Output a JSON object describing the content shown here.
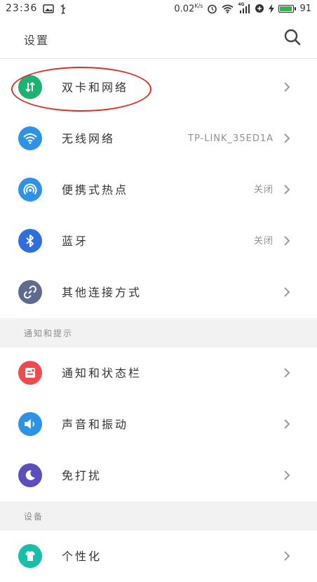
{
  "status_bar": {
    "time": "23:36",
    "speed": "0.02",
    "speed_unit": "K/s",
    "network": "4G",
    "battery_level": "91",
    "battery_fill_percent": 91
  },
  "header": {
    "title": "设置"
  },
  "items_group1": [
    {
      "label": "双卡和网络",
      "value": "",
      "icon": "dual-sim-network-icon",
      "color": "#1fb173"
    },
    {
      "label": "无线网络",
      "value": "TP-LINK_35ED1A",
      "icon": "wifi-icon",
      "color": "#2e93e6"
    },
    {
      "label": "便携式热点",
      "value": "关闭",
      "icon": "hotspot-icon",
      "color": "#2e93e6"
    },
    {
      "label": "蓝牙",
      "value": "关闭",
      "icon": "bluetooth-icon",
      "color": "#2e6fe0"
    },
    {
      "label": "其他连接方式",
      "value": "",
      "icon": "link-icon",
      "color": "#5e6a90"
    }
  ],
  "section_notifications": {
    "title": "通知和提示",
    "items": [
      {
        "label": "通知和状态栏",
        "icon": "notification-icon",
        "color": "#ef4b4f"
      },
      {
        "label": "声音和振动",
        "icon": "sound-icon",
        "color": "#2e93e6"
      },
      {
        "label": "免打扰",
        "icon": "moon-icon",
        "color": "#5b4fbf"
      }
    ]
  },
  "section_device": {
    "title": "设备",
    "items": [
      {
        "label": "个性化",
        "icon": "personalize-icon",
        "color": "#17bfa8"
      }
    ]
  }
}
